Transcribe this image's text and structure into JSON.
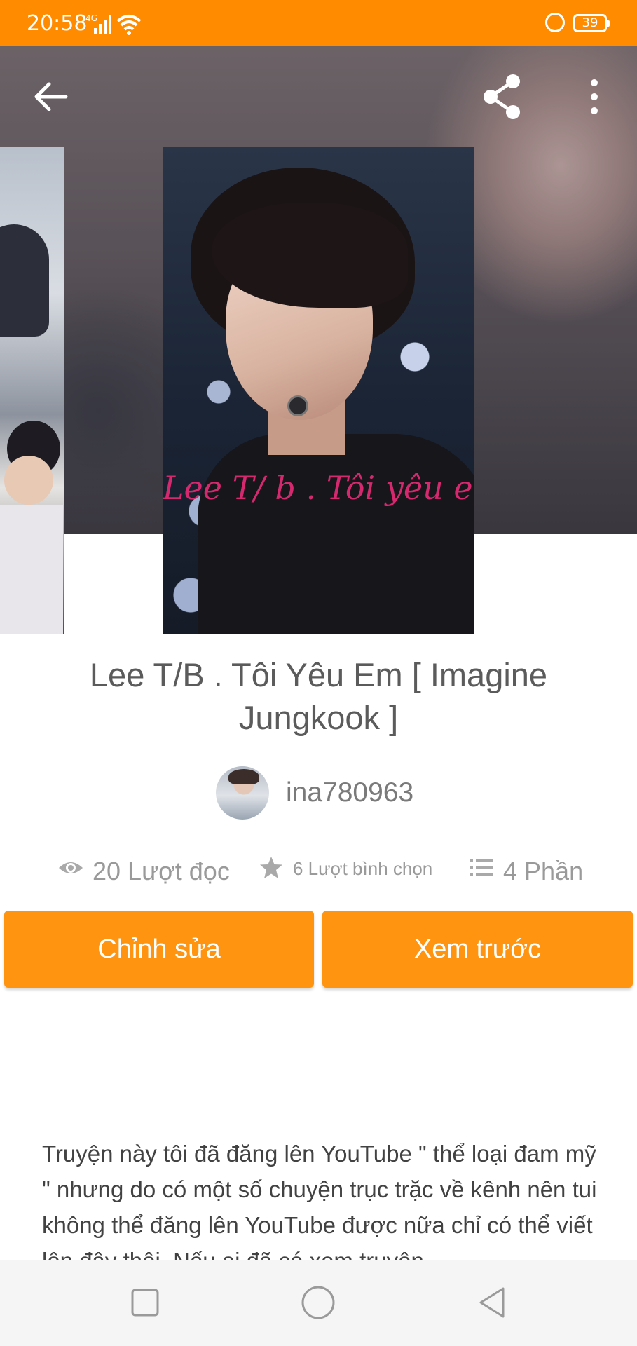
{
  "status_bar": {
    "time": "20:58",
    "network": "4G",
    "battery": "39"
  },
  "toolbar": {
    "back_icon": "arrow-left-icon",
    "share_icon": "share-icon",
    "more_icon": "more-vertical-icon"
  },
  "story": {
    "cover_text": "Lee T/ b . Tôi yêu em",
    "title": "Lee T/B . Tôi Yêu Em [ Imagine Jungkook ]",
    "author": "ina780963",
    "stats": {
      "reads": "20 Lượt đọc",
      "votes": "6 Lượt bình chọn",
      "parts": "4 Phần"
    },
    "description": "Truyện này tôi đã đăng lên YouTube \" thể loại đam mỹ \" nhưng do có một số chuyện trục trặc về kênh nên tui không thể đăng lên YouTube được nữa chỉ có thể viết lên đây thôi. Nếu ai đã có xem truyện"
  },
  "actions": {
    "edit_label": "Chỉnh sửa",
    "preview_label": "Xem trước"
  },
  "colors": {
    "accent": "#ff8c00",
    "button": "#ff9411"
  }
}
